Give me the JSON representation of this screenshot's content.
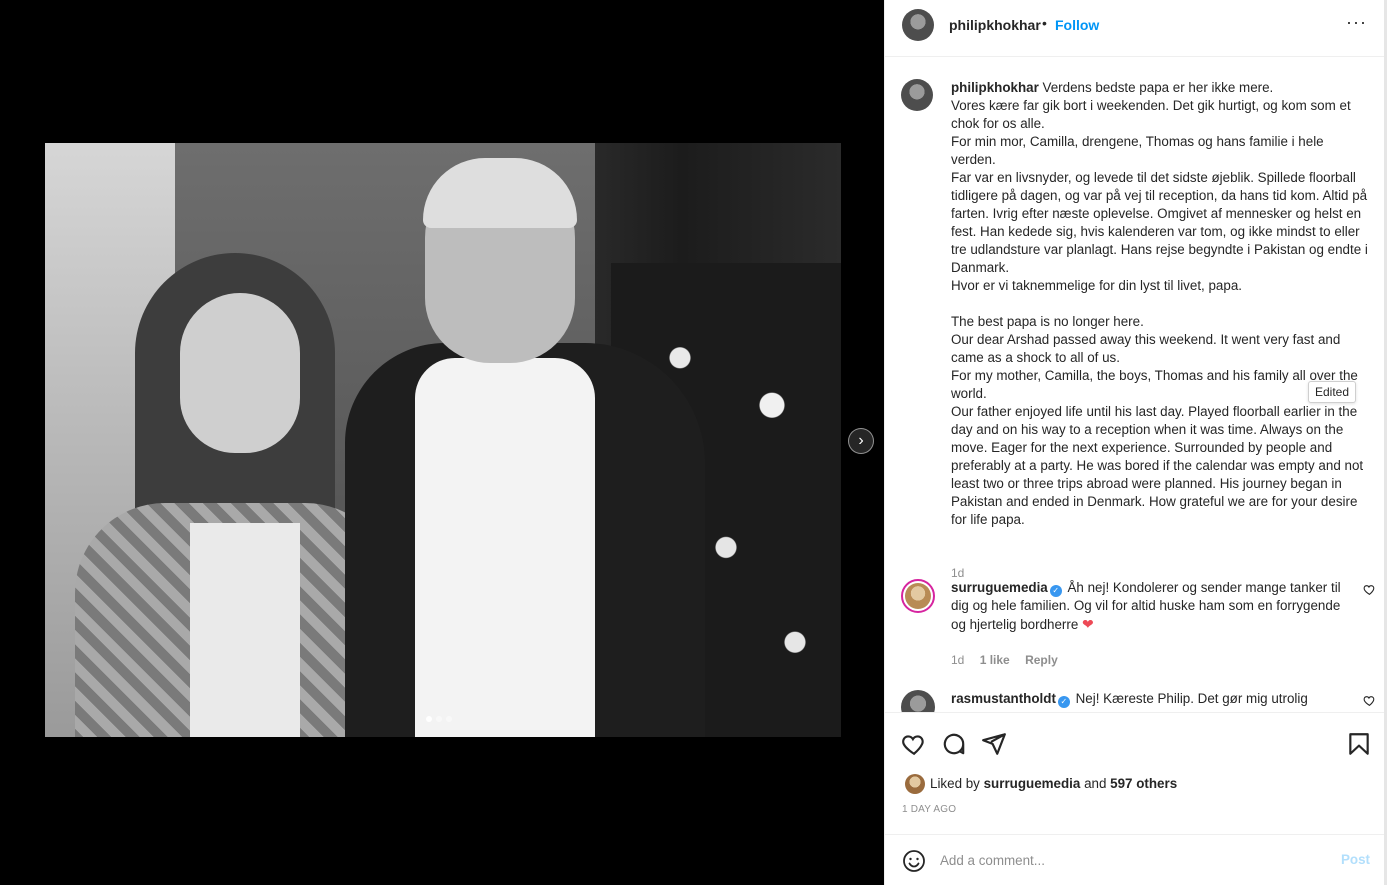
{
  "post": {
    "image_alt": "Black and white photo of a woman and a man standing together next to white daisies",
    "carousel": {
      "total": 3,
      "active": 1
    }
  },
  "header": {
    "username": "philipkhokhar",
    "separator": "•",
    "follow_label": "Follow",
    "more_label": "···"
  },
  "caption": {
    "username": "philipkhokhar",
    "text": " Verdens bedste papa er her ikke mere.\nVores kære far gik bort i weekenden. Det gik hurtigt, og kom som et chok for os alle.\nFor min mor, Camilla, drengene, Thomas og hans familie i hele verden.\nFar var en livsnyder, og levede til det sidste øjeblik. Spillede floorball tidligere på dagen, og var på vej til reception, da hans tid kom. Altid på farten. Ivrig efter næste oplevelse. Omgivet af mennesker og helst en fest. Han kedede sig, hvis kalenderen var tom, og ikke mindst to eller tre udlandsture var planlagt. Hans rejse begyndte i Pakistan og endte i Danmark.\nHvor er vi taknemmelige for din lyst til livet, papa.\n\nThe best papa is no longer here.\nOur dear Arshad passed away this weekend. It went very fast and came as a shock to all of us.\nFor my mother, Camilla, the boys, Thomas and his family all over the world.\nOur father enjoyed life until his last day. Played floorball earlier in the day and on his way to a reception when it was time. Always on the move. Eager for the next experience. Surrounded by people and preferably at a party. He was bored if the calendar was empty and not least two or three trips abroad were planned. His journey began in Pakistan and ended in Denmark. How grateful we are for your desire for life papa.",
    "time": "1d",
    "tooltip": "Edited"
  },
  "comments": [
    {
      "username": "surruguemedia",
      "verified": true,
      "text": " Åh nej! Kondolerer og sender mange tanker til dig og hele familien. Og vil for altid huske ham som en forrygende og hjertelig bordherre ",
      "emoji": "❤",
      "time": "1d",
      "likes": "1 like",
      "reply": "Reply"
    },
    {
      "username": "rasmustantholdt",
      "verified": true,
      "text": " Nej! Kæreste Philip. Det gør mig utrolig"
    }
  ],
  "likes": {
    "prefix": "Liked by ",
    "first_user": "surruguemedia",
    "joiner": " and ",
    "others": "597 others"
  },
  "post_time": "1 DAY AGO",
  "add_comment": {
    "placeholder": "Add a comment...",
    "post_label": "Post"
  },
  "icons": {
    "like": "heart-icon",
    "comment": "comment-bubble-icon",
    "share": "paper-plane-icon",
    "save": "bookmark-icon",
    "emoji": "smiley-icon",
    "next": "chevron-right-icon"
  },
  "colors": {
    "accent": "#0095f6",
    "post_disabled": "#b2dffc",
    "secondary_text": "#8e8e8e",
    "heart": "#ed4956"
  }
}
